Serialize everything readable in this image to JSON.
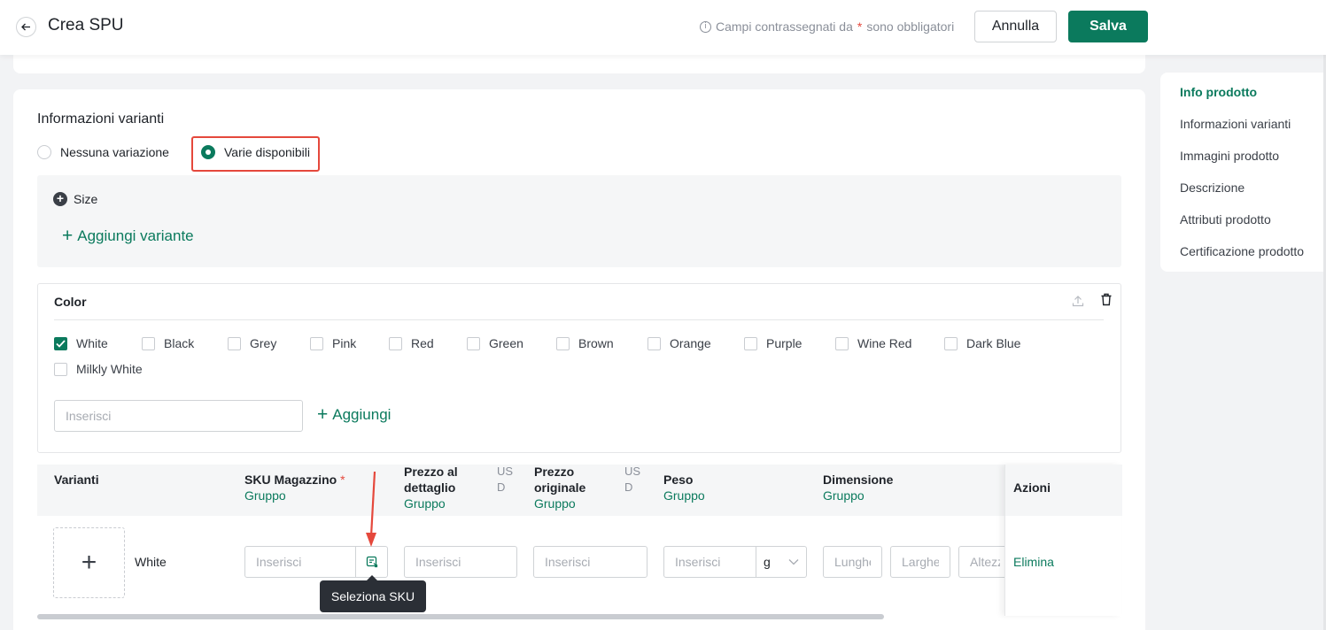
{
  "header": {
    "title": "Crea SPU",
    "required_note_prefix": "Campi contrassegnati da",
    "required_star": "*",
    "required_note_suffix": "sono obbligatori",
    "cancel_label": "Annulla",
    "save_label": "Salva"
  },
  "variants_section": {
    "title": "Informazioni varianti",
    "option_none": "Nessuna variazione",
    "option_multiple": "Varie disponibili",
    "selected_option": "Varie disponibili",
    "size_label": "Size",
    "add_variant_label": "Aggiungi variante"
  },
  "color_panel": {
    "title": "Color",
    "options": [
      {
        "label": "White",
        "checked": true
      },
      {
        "label": "Black",
        "checked": false
      },
      {
        "label": "Grey",
        "checked": false
      },
      {
        "label": "Pink",
        "checked": false
      },
      {
        "label": "Red",
        "checked": false
      },
      {
        "label": "Green",
        "checked": false
      },
      {
        "label": "Brown",
        "checked": false
      },
      {
        "label": "Orange",
        "checked": false
      },
      {
        "label": "Purple",
        "checked": false
      },
      {
        "label": "Wine Red",
        "checked": false
      },
      {
        "label": "Dark Blue",
        "checked": false
      },
      {
        "label": "Milkly White",
        "checked": false
      }
    ],
    "input_placeholder": "Inserisci",
    "add_label": "Aggiungi"
  },
  "table": {
    "columns": {
      "variants": "Varianti",
      "sku": "SKU Magazzino",
      "sku_required": "*",
      "retail_price_1": "Prezzo al",
      "retail_price_2": "dettaglio",
      "original_price_1": "Prezzo",
      "original_price_2": "originale",
      "currency_1": "US",
      "currency_2": "D",
      "weight": "Peso",
      "dimension": "Dimensione",
      "group": "Gruppo",
      "actions": "Azioni"
    },
    "row": {
      "variant_name": "White",
      "sku_placeholder": "Inserisci",
      "retail_placeholder": "Inserisci",
      "original_placeholder": "Inserisci",
      "weight_placeholder": "Inserisci",
      "weight_unit": "g",
      "length_placeholder": "Lunghezza",
      "width_placeholder": "Larghezza",
      "height_placeholder": "Altezza",
      "delete_label": "Elimina"
    },
    "tooltip": "Seleziona SKU"
  },
  "side_nav": {
    "items": [
      {
        "label": "Info prodotto",
        "active": true
      },
      {
        "label": "Informazioni varianti",
        "active": false
      },
      {
        "label": "Immagini prodotto",
        "active": false
      },
      {
        "label": "Descrizione",
        "active": false
      },
      {
        "label": "Attributi prodotto",
        "active": false
      },
      {
        "label": "Certificazione prodotto",
        "active": false
      }
    ]
  },
  "colors": {
    "accent": "#0b7a5d",
    "danger": "#e5483c"
  },
  "icons": {
    "back": "arrow-left-icon",
    "info": "info-circle-icon",
    "add": "plus-circle-icon",
    "upload": "upload-icon",
    "delete": "trash-icon",
    "select_sku": "select-sku-icon",
    "dropdown": "chevron-down-icon"
  }
}
